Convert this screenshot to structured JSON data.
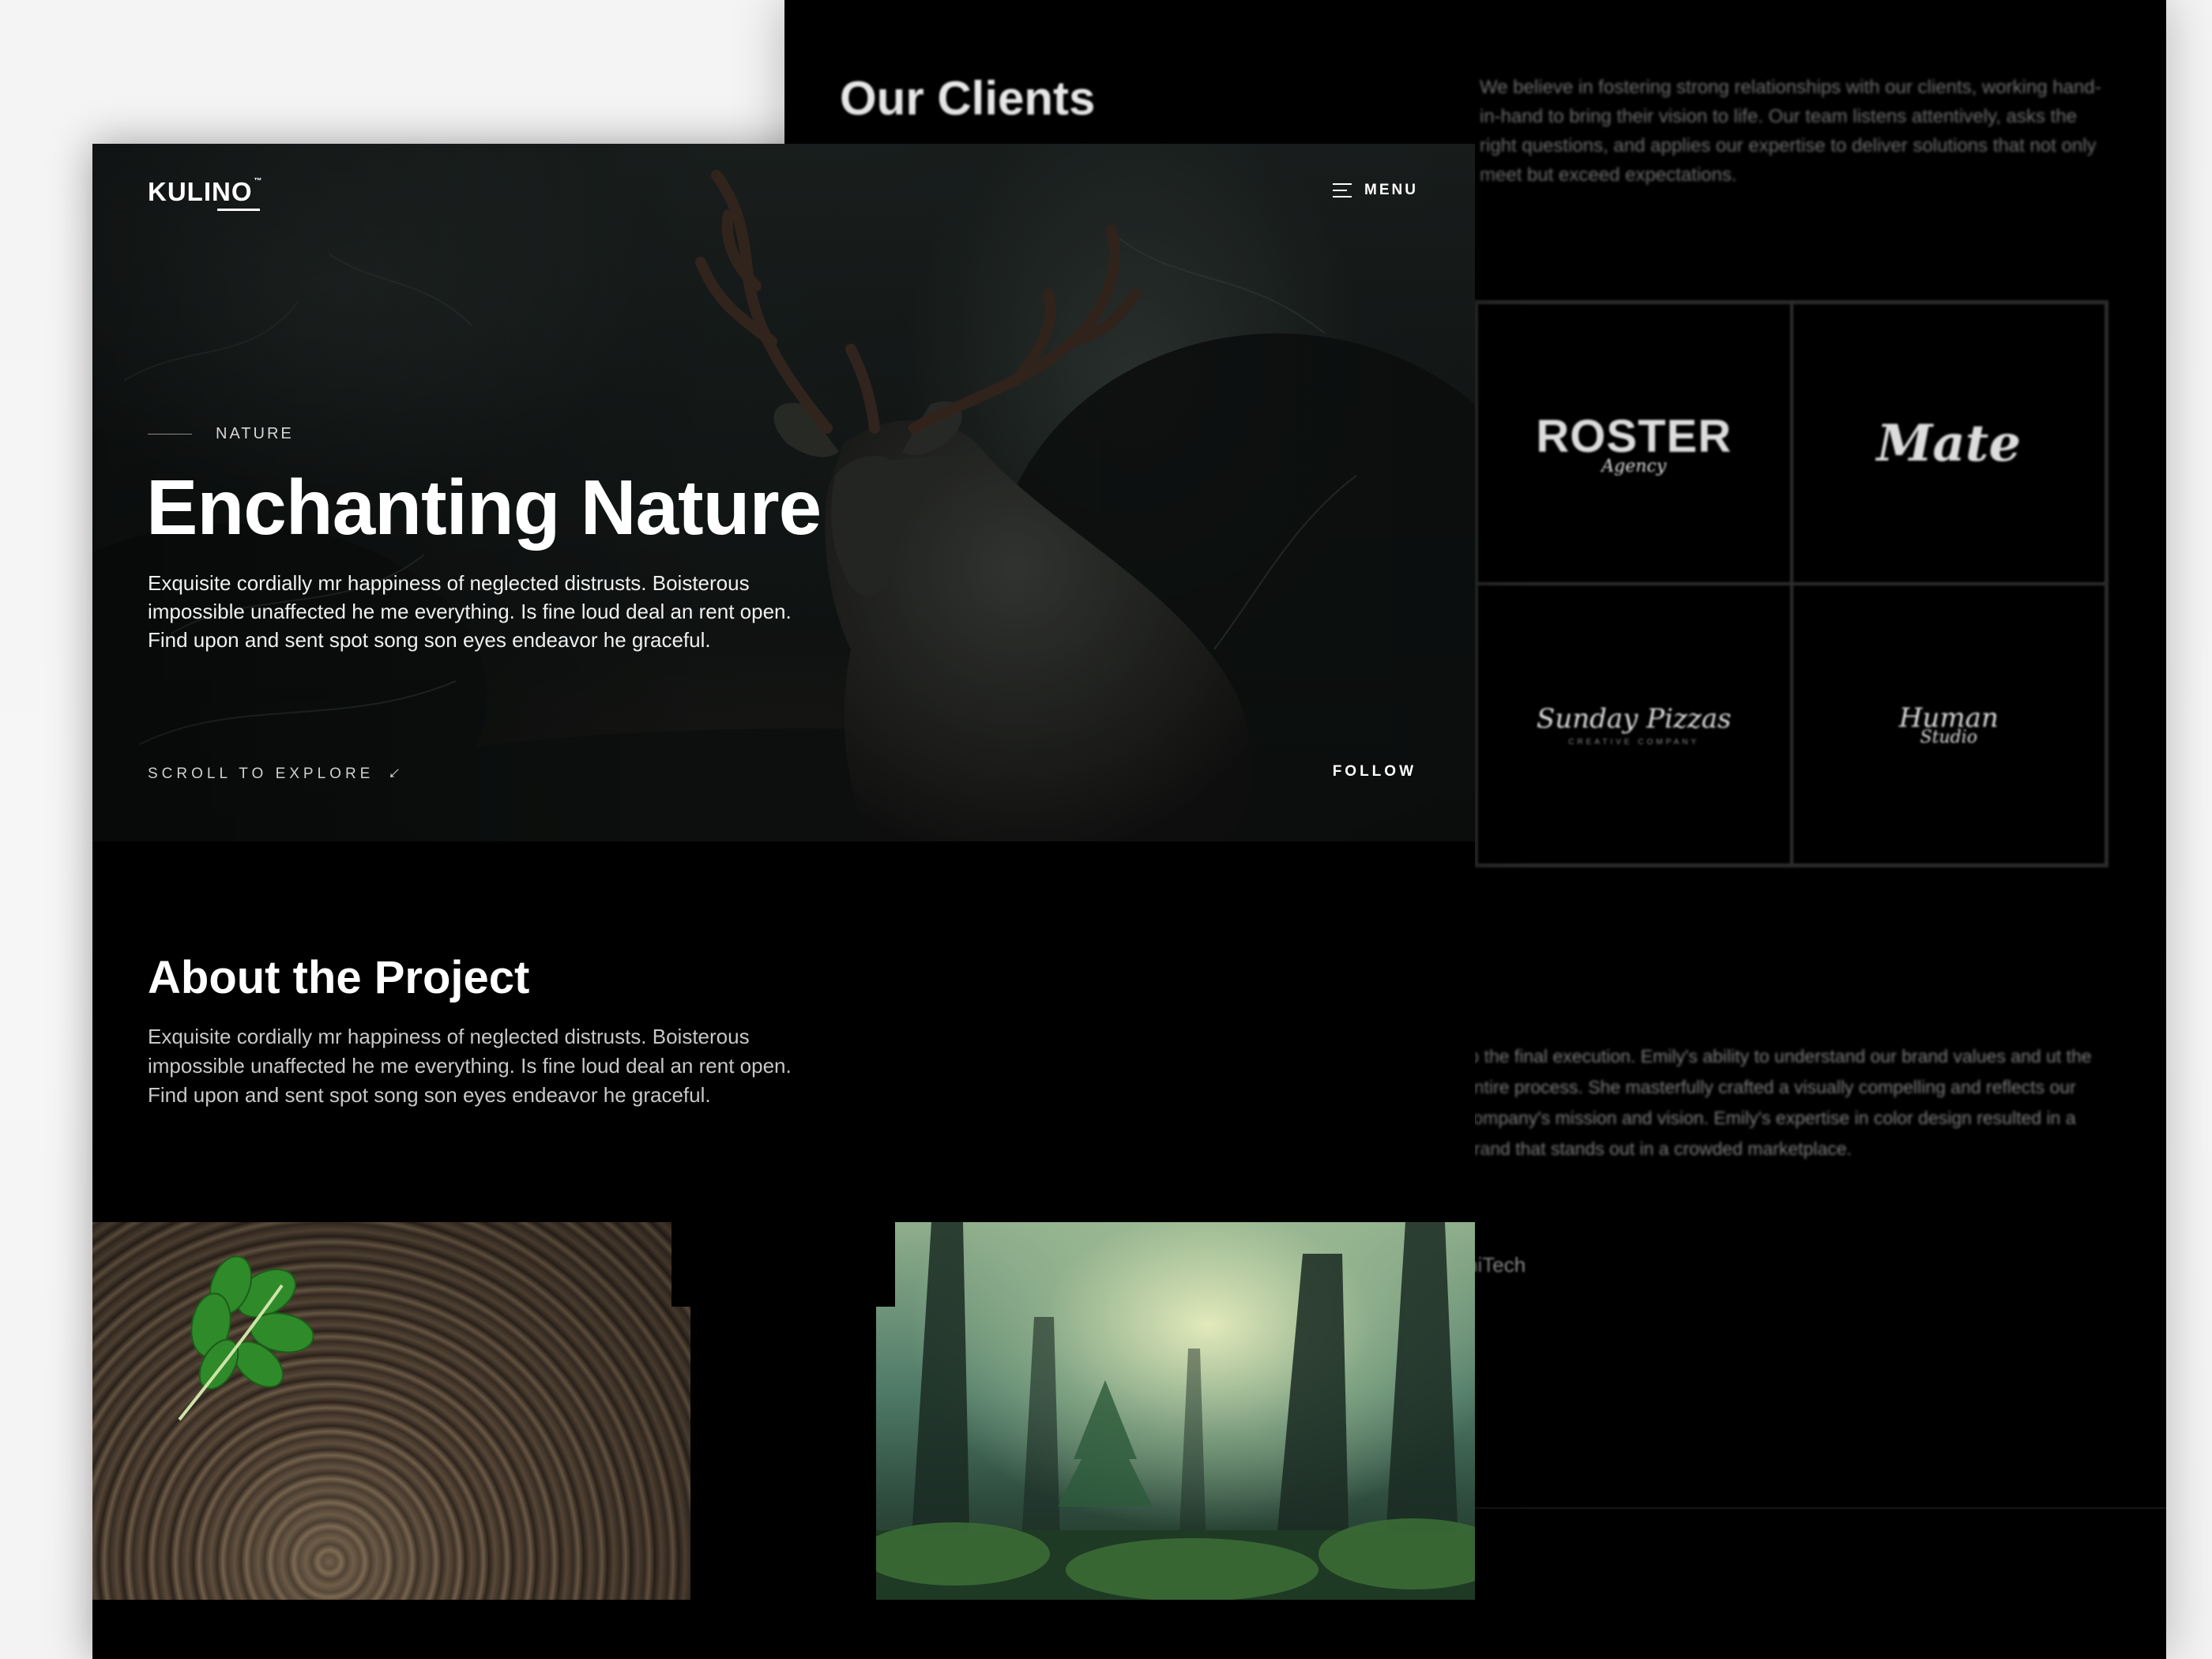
{
  "back_page": {
    "title": "Our Clients",
    "intro": "We believe in fostering strong relationships with our clients, working hand-in-hand to bring their vision to life. Our team listens attentively, asks the right questions, and applies our expertise to deliver solutions that not only meet but exceed expectations.",
    "logos": [
      {
        "main": "ROSTER",
        "sub": "Agency"
      },
      {
        "main": "Mate"
      },
      {
        "main": "Sunday Pizzas",
        "sub": "CREATIVE COMPANY"
      },
      {
        "main": "Human",
        "sub": "Studio"
      }
    ],
    "testimonial": "to the final execution. Emily's ability to understand our brand values and ut the entire process. She masterfully crafted a visually compelling and reflects our company's mission and vision. Emily's expertise in color design resulted in a brand that stands out in a crowded marketplace.",
    "author": "niTech"
  },
  "header": {
    "brand": "KULINO",
    "brand_mark": "™",
    "menu_label": "MENU"
  },
  "hero": {
    "eyebrow": "NATURE",
    "title": "Enchanting Nature",
    "text": "Exquisite cordially mr happiness of neglected distrusts. Boisterous impossible unaffected he me everything. Is fine loud deal an rent open. Find upon and sent spot song son eyes endeavor he graceful.",
    "scroll_label": "SCROLL TO EXPLORE",
    "follow_label": "FOLLOW"
  },
  "about": {
    "title": "About the Project",
    "text": "Exquisite cordially mr happiness of neglected distrusts. Boisterous impossible unaffected he me everything. Is fine loud deal an rent open. Find upon and sent spot song son eyes endeavor he graceful."
  },
  "icons": {
    "menu": "hamburger-icon",
    "scroll_arrow": "arrow-down-right-icon"
  },
  "colors": {
    "background": "#000000",
    "text": "#ffffff",
    "muted_text": "#c8c8c8"
  }
}
